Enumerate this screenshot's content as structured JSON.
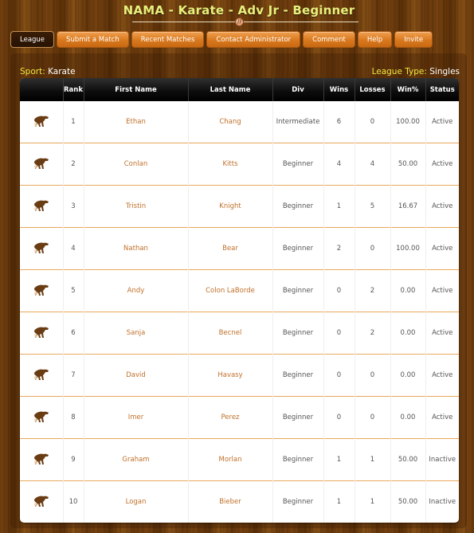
{
  "header": {
    "title": "NAMA - Karate - Adv Jr - Beginner",
    "divider_icon": "ball-icon"
  },
  "nav": {
    "items": [
      {
        "label": "League",
        "active": true
      },
      {
        "label": "Submit a Match",
        "active": false
      },
      {
        "label": "Recent Matches",
        "active": false
      },
      {
        "label": "Contact Administrator",
        "active": false
      },
      {
        "label": "Comment",
        "active": false
      },
      {
        "label": "Help",
        "active": false
      },
      {
        "label": "Invite",
        "active": false
      }
    ]
  },
  "info": {
    "sport_label": "Sport:",
    "sport_value": "Karate",
    "league_type_label": "League Type:",
    "league_type_value": "Singles"
  },
  "table": {
    "columns": [
      "",
      "Rank",
      "First Name",
      "Last Name",
      "Div",
      "Wins",
      "Losses",
      "Win%",
      "Status"
    ],
    "row_icon": "panther-icon",
    "rows": [
      {
        "rank": "1",
        "first": "Ethan",
        "last": "Chang",
        "div": "Intermediate",
        "wins": "6",
        "losses": "0",
        "pct": "100.00",
        "status": "Active"
      },
      {
        "rank": "2",
        "first": "Conlan",
        "last": "Kitts",
        "div": "Beginner",
        "wins": "4",
        "losses": "4",
        "pct": "50.00",
        "status": "Active"
      },
      {
        "rank": "3",
        "first": "Tristin",
        "last": "Knight",
        "div": "Beginner",
        "wins": "1",
        "losses": "5",
        "pct": "16.67",
        "status": "Active"
      },
      {
        "rank": "4",
        "first": "Nathan",
        "last": "Bear",
        "div": "Beginner",
        "wins": "2",
        "losses": "0",
        "pct": "100.00",
        "status": "Active"
      },
      {
        "rank": "5",
        "first": "Andy",
        "last": "Colon LaBorde",
        "div": "Beginner",
        "wins": "0",
        "losses": "2",
        "pct": "0.00",
        "status": "Active"
      },
      {
        "rank": "6",
        "first": "Sanja",
        "last": "Becnel",
        "div": "Beginner",
        "wins": "0",
        "losses": "2",
        "pct": "0.00",
        "status": "Active"
      },
      {
        "rank": "7",
        "first": "David",
        "last": "Havasy",
        "div": "Beginner",
        "wins": "0",
        "losses": "0",
        "pct": "0.00",
        "status": "Active"
      },
      {
        "rank": "8",
        "first": "Imer",
        "last": "Perez",
        "div": "Beginner",
        "wins": "0",
        "losses": "0",
        "pct": "0.00",
        "status": "Active"
      },
      {
        "rank": "9",
        "first": "Graham",
        "last": "Morlan",
        "div": "Beginner",
        "wins": "1",
        "losses": "1",
        "pct": "50.00",
        "status": "Inactive"
      },
      {
        "rank": "10",
        "first": "Logan",
        "last": "Bieber",
        "div": "Beginner",
        "wins": "1",
        "losses": "1",
        "pct": "50.00",
        "status": "Inactive"
      }
    ]
  },
  "colors": {
    "title": "#e8f07c",
    "label_yellow": "#f0e640",
    "button_orange": "#d9791e",
    "active_button": "#271204",
    "name_link": "#c0702a",
    "row_divider": "#e8a85c"
  }
}
